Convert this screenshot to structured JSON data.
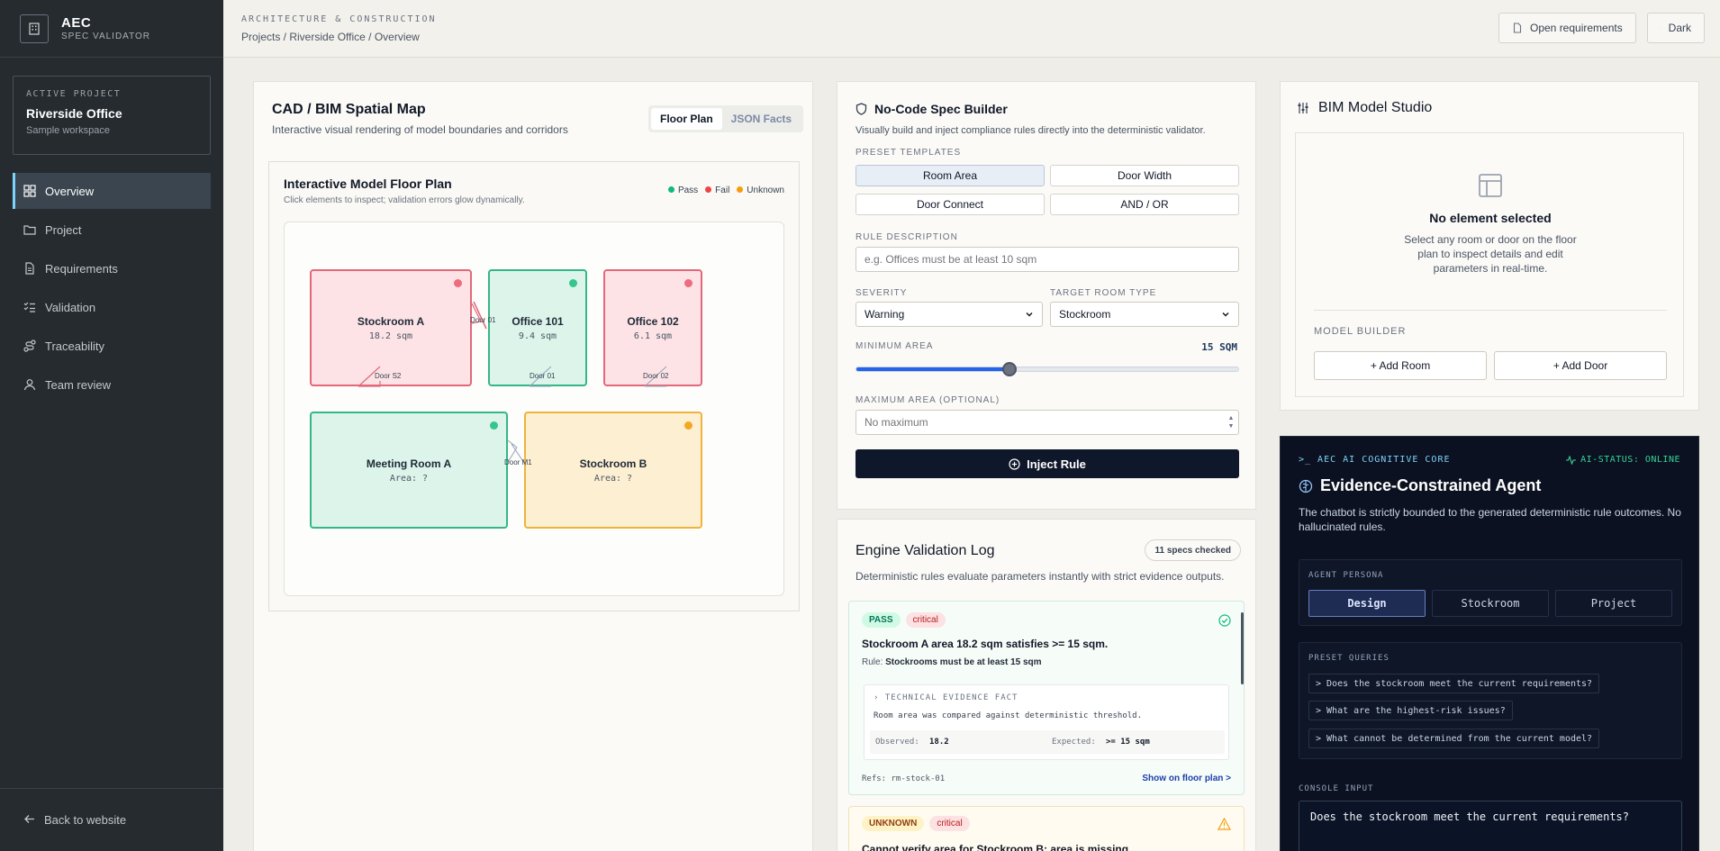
{
  "sidebar": {
    "brand_title": "AEC",
    "brand_sub": "SPEC VALIDATOR",
    "project_kicker": "ACTIVE PROJECT",
    "project_name": "Riverside Office",
    "project_desc": "Sample workspace",
    "items": [
      {
        "label": "Overview",
        "icon": "grid-icon",
        "active": true
      },
      {
        "label": "Project",
        "icon": "folder-icon"
      },
      {
        "label": "Requirements",
        "icon": "document-icon"
      },
      {
        "label": "Validation",
        "icon": "checklist-icon"
      },
      {
        "label": "Traceability",
        "icon": "route-icon"
      },
      {
        "label": "Team review",
        "icon": "user-icon"
      }
    ],
    "back_label": "Back to website"
  },
  "topbar": {
    "kicker": "ARCHITECTURE & CONSTRUCTION",
    "breadcrumb": "Projects / Riverside Office / Overview",
    "open_req_label": "Open requirements",
    "theme_label": "Dark"
  },
  "spatial": {
    "title": "CAD / BIM Spatial Map",
    "subtitle": "Interactive visual rendering of model boundaries and corridors",
    "tabs": [
      "Floor Plan",
      "JSON Facts"
    ],
    "plan_title": "Interactive Model Floor Plan",
    "plan_sub": "Click elements to inspect; validation errors glow dynamically.",
    "legend": [
      {
        "label": "Pass",
        "color": "#10b981"
      },
      {
        "label": "Fail",
        "color": "#ef4444"
      },
      {
        "label": "Unknown",
        "color": "#f59e0b"
      }
    ],
    "rooms": {
      "stockroom_a": {
        "name": "Stockroom A",
        "area": "18.2 sqm"
      },
      "office_101": {
        "name": "Office 101",
        "area": "9.4 sqm"
      },
      "office_102": {
        "name": "Office 102",
        "area": "6.1 sqm"
      },
      "meeting_a": {
        "name": "Meeting Room A",
        "area": "Area: ?"
      },
      "stockroom_b": {
        "name": "Stockroom B",
        "area": "Area: ?"
      }
    },
    "doors": {
      "d01a": "Door 01",
      "ds2": "Door S2",
      "d01b": "Door 01",
      "d02": "Door 02",
      "dm1": "Door M1"
    }
  },
  "builder": {
    "title": "No-Code Spec Builder",
    "subtitle": "Visually build and inject compliance rules directly into the deterministic validator.",
    "templates_label": "PRESET TEMPLATES",
    "templates": [
      "Room Area",
      "Door Width",
      "Door Connect",
      "AND / OR"
    ],
    "rule_desc_label": "RULE DESCRIPTION",
    "rule_desc_placeholder": "e.g. Offices must be at least 10 sqm",
    "severity_label": "SEVERITY",
    "severity_value": "Warning",
    "target_label": "TARGET ROOM TYPE",
    "target_value": "Stockroom",
    "min_area_label": "MINIMUM AREA",
    "min_area_value": "15 SQM",
    "min_area_fraction": 0.4,
    "max_area_label": "MAXIMUM AREA (OPTIONAL)",
    "max_area_placeholder": "No maximum",
    "inject_label": "Inject Rule"
  },
  "log": {
    "title": "Engine Validation Log",
    "count_badge": "11 specs checked",
    "subtitle": "Deterministic rules evaluate parameters instantly with strict evidence outputs.",
    "entry1": {
      "status": "PASS",
      "severity": "critical",
      "title": "Stockroom A area 18.2 sqm satisfies >= 15 sqm.",
      "rule_prefix": "Rule:",
      "rule": "Stockrooms must be at least 15 sqm",
      "evidence_label": "TECHNICAL EVIDENCE FACT",
      "evidence_text": "Room area was compared against deterministic threshold.",
      "observed_label": "Observed:",
      "observed": "18.2",
      "expected_label": "Expected:",
      "expected": ">= 15 sqm",
      "refs": "Refs: rm-stock-01",
      "link": "Show on floor plan >"
    },
    "entry2": {
      "status": "UNKNOWN",
      "severity": "critical",
      "title": "Cannot verify area for Stockroom B; area is missing."
    }
  },
  "studio": {
    "title": "BIM Model Studio",
    "empty_title": "No element selected",
    "empty_text": "Select any room or door on the floor plan to inspect details and edit parameters in real-time.",
    "builder_label": "MODEL BUILDER",
    "add_room": "+ Add Room",
    "add_door": "+ Add Door"
  },
  "agent": {
    "core_label": ">_ AEC AI COGNITIVE CORE",
    "status": "AI-STATUS: ONLINE",
    "title": "Evidence-Constrained Agent",
    "desc": "The chatbot is strictly bounded to the generated deterministic rule outcomes. No hallucinated rules.",
    "persona_label": "AGENT PERSONA",
    "personas": [
      "Design",
      "Stockroom",
      "Project"
    ],
    "queries_label": "PRESET QUERIES",
    "queries": [
      "> Does the stockroom meet the current requirements?",
      "> What are the highest-risk issues?",
      "> What cannot be determined from the current model?"
    ],
    "console_label": "CONSOLE INPUT",
    "console_value": "Does the stockroom meet the current requirements?"
  }
}
